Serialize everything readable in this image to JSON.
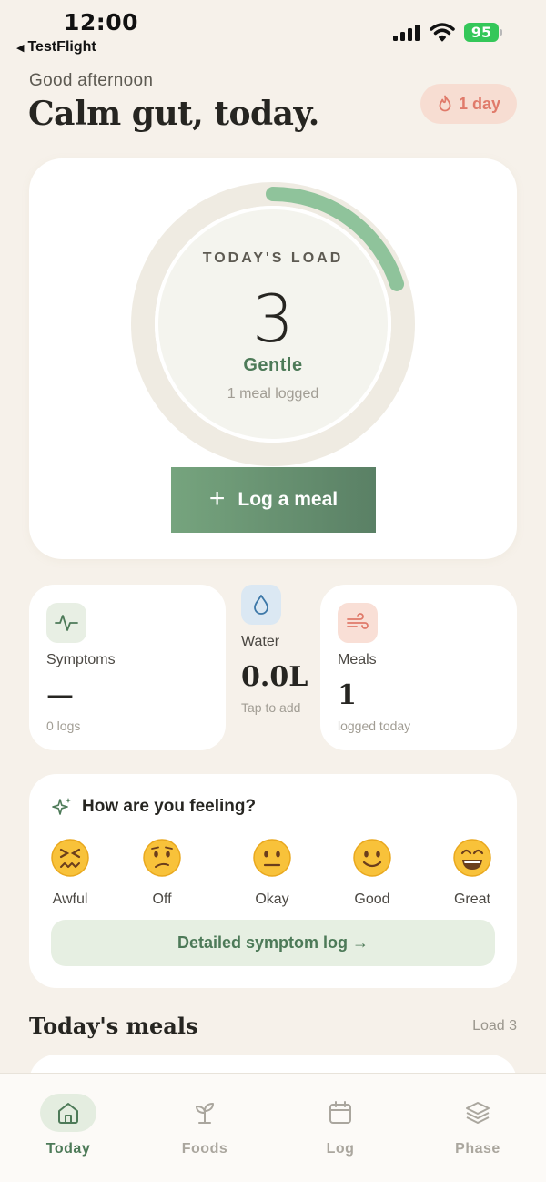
{
  "status_bar": {
    "time": "12:00",
    "back_app": "TestFlight",
    "battery": "95"
  },
  "header": {
    "greeting": "Good afternoon",
    "headline": "Calm gut, today.",
    "streak": "1 day"
  },
  "load": {
    "title": "TODAY'S LOAD",
    "value": "3",
    "level": "Gentle",
    "subtitle": "1 meal logged",
    "ring_fraction": 0.2,
    "log_button": "Log a meal"
  },
  "stats": {
    "symptoms": {
      "label": "Symptoms",
      "value": "—",
      "sub": "0 logs",
      "icon": "activity-icon"
    },
    "water": {
      "label": "Water",
      "value": "0.0L",
      "sub": "Tap to add",
      "icon": "droplet-icon"
    },
    "meals": {
      "label": "Meals",
      "value": "1",
      "sub": "logged today",
      "icon": "wind-icon"
    }
  },
  "feeling": {
    "title": "How are you feeling?",
    "moods": [
      {
        "label": "Awful",
        "emoji": "confounded-face"
      },
      {
        "label": "Off",
        "emoji": "confused-face"
      },
      {
        "label": "Okay",
        "emoji": "neutral-face"
      },
      {
        "label": "Good",
        "emoji": "slightly-smiling-face"
      },
      {
        "label": "Great",
        "emoji": "grinning-face"
      }
    ],
    "detail_button": "Detailed symptom log →"
  },
  "meals_section": {
    "title": "Today's meals",
    "load": "Load 3"
  },
  "tabs": [
    {
      "label": "Today",
      "icon": "home-icon",
      "active": true
    },
    {
      "label": "Foods",
      "icon": "sprout-icon",
      "active": false
    },
    {
      "label": "Log",
      "icon": "calendar-icon",
      "active": false
    },
    {
      "label": "Phase",
      "icon": "layers-icon",
      "active": false
    }
  ],
  "colors": {
    "accent": "#4d7a58",
    "ring": "#8fc39b",
    "background": "#f6f1ea",
    "streak": "#e07a6a"
  }
}
